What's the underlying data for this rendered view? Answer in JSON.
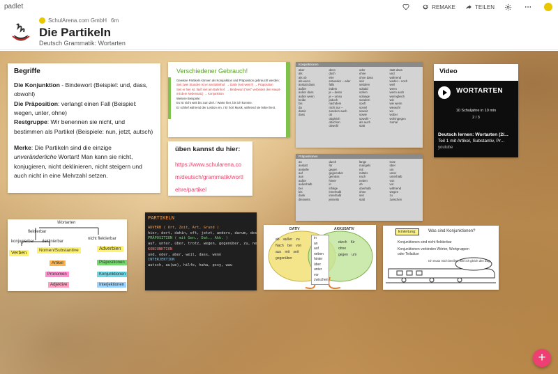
{
  "app": {
    "brand": "padlet"
  },
  "topbar": {
    "remake_label": "REMAKE",
    "share_label": "TEILEN"
  },
  "header": {
    "author": "SchulArena.com GmbH",
    "time": "6m",
    "title": "Die Partikeln",
    "subtitle": "Deutsch Grammatik: Wortarten"
  },
  "cards": {
    "begriffe": {
      "title": "Begriffe",
      "konj_term": "Die Konjunktion",
      "konj_text": " - Bindewort (Beispiel: und, dass, obwohl)",
      "prae_term": "Die Präposition",
      "prae_text": ":  verlangt einen Fall (Beispiel: wegen, unter, ohne)",
      "rest_term": "Restgruppe",
      "rest_text": ": Wir benennen sie nicht,  und bestimmen als Partikel (Beispiele: nun, jetzt, autsch)",
      "merke_term": "Merke",
      "merke_a": ": Die Partikeln sind die einzige ",
      "merke_em": "unveränderliche",
      "merke_b": " Wortart! Man kann sie nicht, konjugieren, nicht deklinieren, nicht steigern und auch nicht in eine Mehrzahl setzen."
    },
    "gebrauch": {
      "title": "Verschiedener Gebrauch!",
      "line1": "Gewisse Partikeln können als Konjunktion und Präposition gebraucht werden:",
      "line2": "Seit zwei Stunden ist er am Bahnhof. → Dativ (seit wem?) → Präposition",
      "line3": "Seit er hier ist, läuft viel am Bahnhof. → Bindewort (\"seit\" verbindet den Haupt- mit dem Nebensatz) → Konjunktion",
      "line4": "Weitere Beispiele:",
      "line5": "Es ist nicht weit bis zum Ziel. / Warte hier, bis ich komme.",
      "line6": "Er schlief während der Lektion ein. / Er hört Musik, während sie lieber liest."
    },
    "ueben": {
      "title": "üben kannst du hier:",
      "link": "https://www.schularena.com/deutsch/grammatik/wortlehre/partikel"
    },
    "konjunktionen": {
      "header": "Konjunktionen",
      "col1": [
        "aber",
        "als",
        "als ob",
        "als wenn",
        "anstatt dass",
        "außer",
        "außer dass",
        "außer wenn",
        "beide",
        "bis",
        "da",
        "damit",
        "dass"
      ],
      "col2": [
        "denn",
        "doch",
        "ehe",
        "entweder – oder",
        "falls",
        "indem",
        "je – desto",
        "je – umso",
        "jedoch",
        "nachdem",
        "nicht nur –",
        "sondern auch",
        "ob",
        "obgleich",
        "obschon",
        "obwohl"
      ],
      "col3": [
        "oder",
        "ohne",
        "ohne dass",
        "seit",
        "seitdem",
        "sobald",
        "sofern",
        "solange",
        "sondern",
        "sooft",
        "soviel",
        "soweit",
        "sowie",
        "sowohl –",
        "als auch",
        "statt"
      ],
      "col4": [
        "statt dass",
        "und",
        "während",
        "weder – noch",
        "weil",
        "wenn",
        "wenn auch",
        "wenngleich",
        "wie",
        "wie wenn",
        "wiewohl",
        "wo",
        "wobei",
        "wohingegen",
        "zumal"
      ]
    },
    "praepositionen": {
      "header": "Präpositionen",
      "col1": [
        "an",
        "anstatt",
        "anstelle",
        "auf",
        "aus",
        "außer",
        "außerhalb",
        "bei",
        "bis",
        "dank",
        "diesseits"
      ],
      "col2": [
        "durch",
        "für",
        "gegen",
        "gegenüber",
        "gemäss",
        "hinter",
        "in",
        "infolge",
        "innerhalb",
        "innerhalb",
        "jenseits"
      ],
      "col3": [
        "längs",
        "mangels",
        "mit",
        "mittels",
        "nach",
        "neben",
        "ob",
        "oberhalb",
        "ohne",
        "seit",
        "statt"
      ],
      "col4": [
        "trotz",
        "über",
        "um",
        "unter",
        "unterhalb",
        "von",
        "vor",
        "während",
        "wegen",
        "zu",
        "zwischen"
      ]
    },
    "video": {
      "title": "Video",
      "logo": "WORTARTEN",
      "episode": "10 Schuljahre in 10 min",
      "part": "2 / 3",
      "caption": "Deutsch lernen: Wortarten (2/...",
      "caption2": "Teil 1 mit Artikel, Substantiv, Pr...",
      "source": "youtube"
    },
    "wortarten": {
      "head": "Wortarten",
      "flektierbar": "flektierbar",
      "konjugierbar": "konjugierbar",
      "deklinierbar": "deklinierbar",
      "nicht_flektierbar": "nicht flektierbar",
      "verben": "Verben",
      "nomen": "Nomen/Substantive",
      "adverbien": "Adverbien",
      "artikel": "Artikel",
      "praep": "Präpositionen",
      "pronomen": "Pronomen",
      "konj": "Konjunktionen",
      "adjektive": "Adjektive",
      "interj": "Interjektionen"
    },
    "chalk": {
      "title": "PARTIKELN",
      "l1": "ADVERB  ( Ort, Zeit, Art, Grund )",
      "l2": "hier, dort, dahin, oft, jetzt, anders, darum, deshalb",
      "l3": "PRÄPOSITION  ( mit Gen., Dat., Akk. )",
      "l4": "auf, unter, über, trotz, wegen, gegenüber, zu, neben, in",
      "l5": "KONJUNKTION",
      "l6": "und, oder, aber, weil, dass, wenn",
      "l7": "INTERJEKTION",
      "l8": "autsch, au(we), hilfe, haha, pssy, wau"
    },
    "venn": {
      "dativ": "DATIV",
      "akkusativ": "AKKUSATIV",
      "left": [
        "ab",
        "außer",
        "zu",
        "Nach",
        "bei",
        "von",
        "aus",
        "mit",
        "seit",
        "gegenüber"
      ],
      "mid": [
        "in",
        "an",
        "auf",
        "neben",
        "hinter",
        "über",
        "unter",
        "vor",
        "zwischen"
      ],
      "right": [
        "durch",
        "für",
        "ohne",
        "gegen",
        "um"
      ]
    },
    "sketch": {
      "label": "Einleitung:",
      "question": "Was sind Konjunktionen?",
      "b1": "Konjunktionen sind nicht flektierbar",
      "b2": "Konjunktionen verbinden Wörter, Wortgruppen oder Teilsätze",
      "train": "Ich muss mich beeilen, weil ich gleich den Zug"
    }
  }
}
